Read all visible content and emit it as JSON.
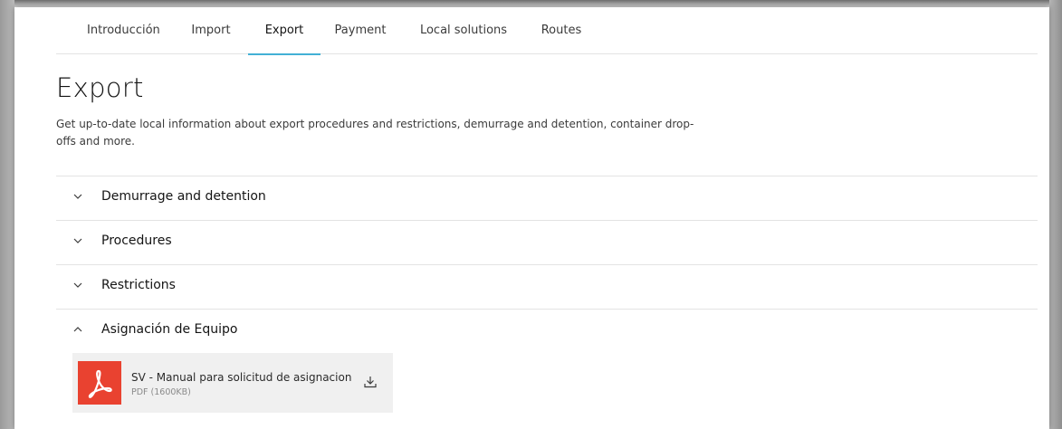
{
  "tabs": [
    {
      "label": "Introducción"
    },
    {
      "label": "Import"
    },
    {
      "label": "Export"
    },
    {
      "label": "Payment"
    },
    {
      "label": "Local solutions"
    },
    {
      "label": "Routes"
    }
  ],
  "active_tab": "Export",
  "page": {
    "title": "Export",
    "description_line1": "Get up-to-date local information about export procedures and restrictions, demurrage and detention, container drop-",
    "description_line2": "offs and more."
  },
  "accordion": [
    {
      "label": "Demurrage and detention",
      "expanded": false
    },
    {
      "label": "Procedures",
      "expanded": false
    },
    {
      "label": "Restrictions",
      "expanded": false
    },
    {
      "label": "Asignación de Equipo",
      "expanded": true
    }
  ],
  "file": {
    "name": "SV - Manual para solicitud de asignacion",
    "meta": "PDF (1600KB)",
    "icon": "pdf-icon"
  },
  "colors": {
    "accent": "#42b0d5",
    "pdf_red": "#e94230",
    "divider": "#e3e3e3"
  }
}
